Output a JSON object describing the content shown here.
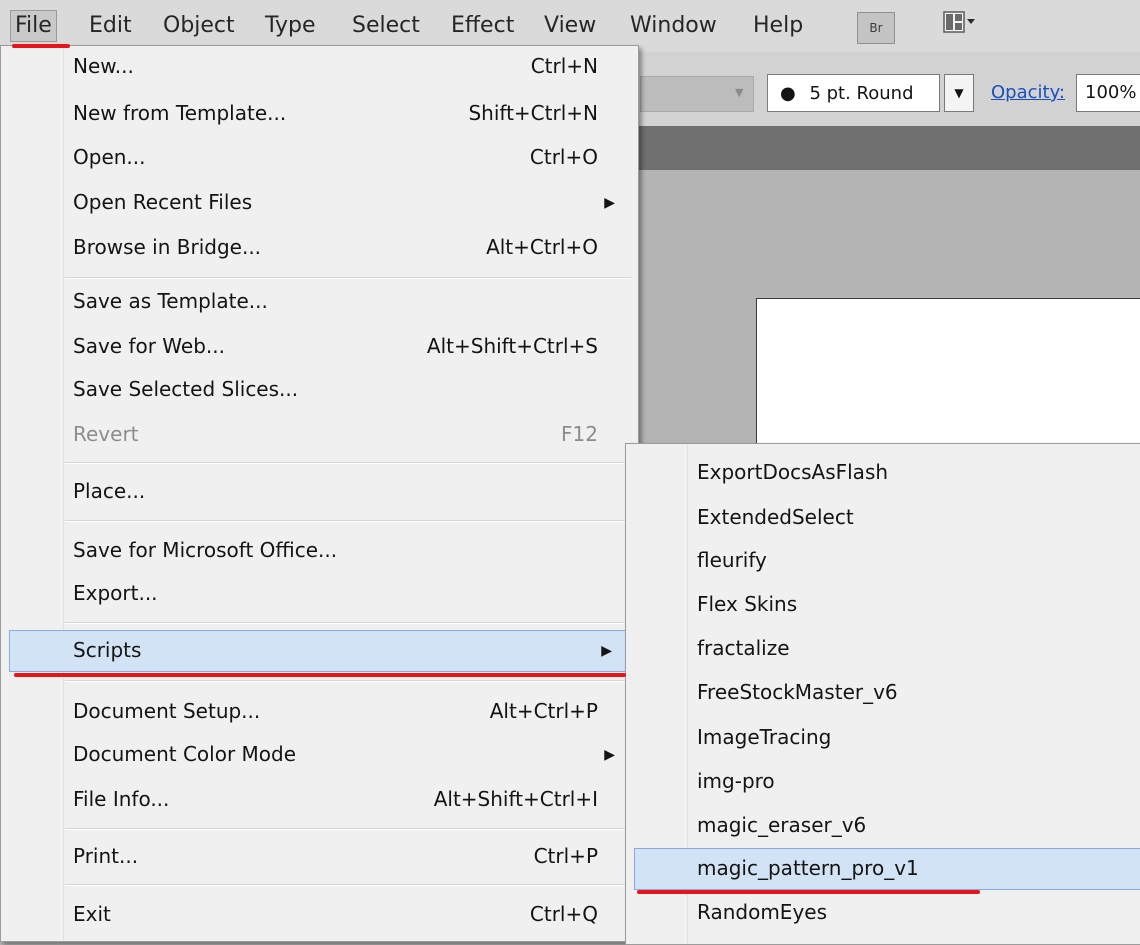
{
  "menubar": {
    "items": [
      "File",
      "Edit",
      "Object",
      "Type",
      "Select",
      "Effect",
      "View",
      "Window",
      "Help"
    ],
    "bridge_label": "Br"
  },
  "control_bar": {
    "brush_value": "5 pt. Round",
    "opacity_label": "Opacity:",
    "opacity_value": "100%"
  },
  "file_menu": {
    "items": [
      {
        "label": "New...",
        "shortcut": "Ctrl+N"
      },
      {
        "label": "New from Template...",
        "shortcut": "Shift+Ctrl+N"
      },
      {
        "label": "Open...",
        "shortcut": "Ctrl+O"
      },
      {
        "label": "Open Recent Files",
        "submenu": true
      },
      {
        "label": "Browse in Bridge...",
        "shortcut": "Alt+Ctrl+O"
      },
      {
        "label": "Save as Template..."
      },
      {
        "label": "Save for Web...",
        "shortcut": "Alt+Shift+Ctrl+S"
      },
      {
        "label": "Save Selected Slices..."
      },
      {
        "label": "Revert",
        "shortcut": "F12",
        "disabled": true
      },
      {
        "label": "Place..."
      },
      {
        "label": "Save for Microsoft Office..."
      },
      {
        "label": "Export..."
      },
      {
        "label": "Scripts",
        "submenu": true,
        "highlighted": true
      },
      {
        "label": "Document Setup...",
        "shortcut": "Alt+Ctrl+P"
      },
      {
        "label": "Document Color Mode",
        "submenu": true
      },
      {
        "label": "File Info...",
        "shortcut": "Alt+Shift+Ctrl+I"
      },
      {
        "label": "Print...",
        "shortcut": "Ctrl+P"
      },
      {
        "label": "Exit",
        "shortcut": "Ctrl+Q"
      }
    ]
  },
  "scripts_submenu": {
    "items": [
      "ExportDocsAsFlash",
      "ExtendedSelect",
      "fleurify",
      "Flex Skins",
      "fractalize",
      "FreeStockMaster_v6",
      "ImageTracing",
      "img-pro",
      "magic_eraser_v6",
      "magic_pattern_pro_v1",
      "RandomEyes"
    ],
    "highlighted": "magic_pattern_pro_v1"
  },
  "icons": {
    "submenu_arrow": "triangle-right-icon",
    "dropdown_arrow": "triangle-down-icon",
    "brush_dot": "bullet-icon",
    "workspace": "workspace-switcher-icon"
  },
  "colors": {
    "highlight_bg": "#d2e3f5",
    "highlight_border": "#84ace0",
    "annotation_red": "#e8141b",
    "menu_bg": "#f0f0f0"
  }
}
